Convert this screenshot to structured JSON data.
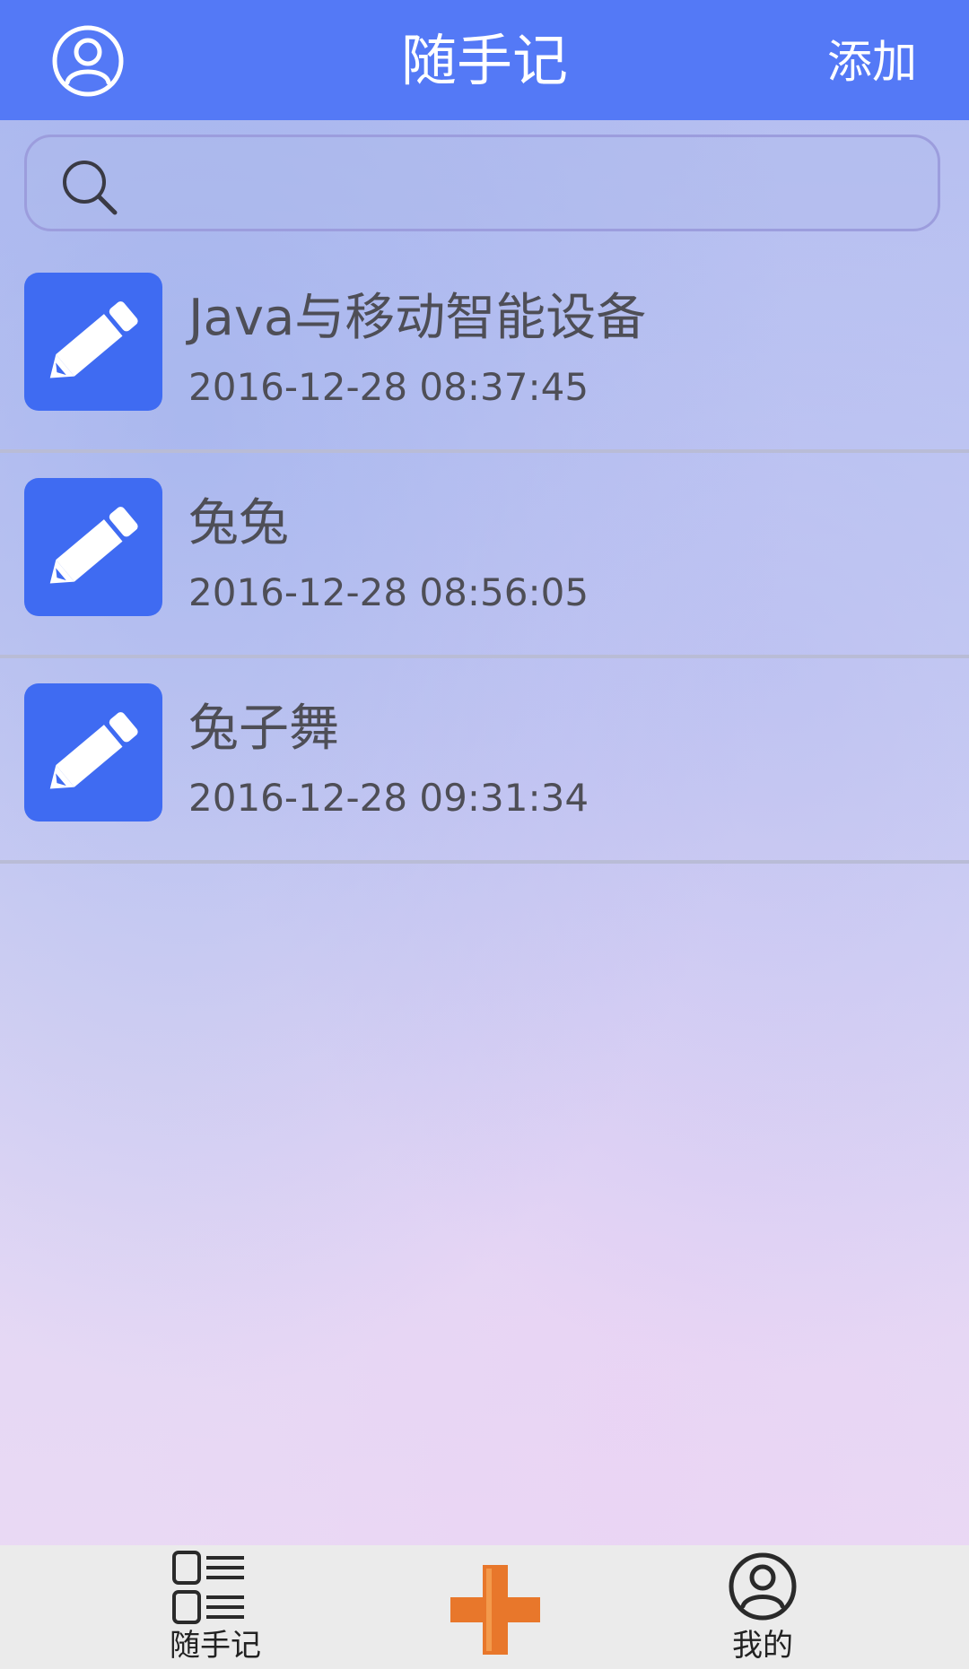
{
  "header": {
    "title": "随手记",
    "add_label": "添加",
    "avatar_icon": "user-circle-icon",
    "background_color": "#5479f6"
  },
  "search": {
    "placeholder": "",
    "value": "",
    "icon": "search-icon"
  },
  "notes": [
    {
      "title": "Java与移动智能设备",
      "time": "2016-12-28 08:37:45",
      "icon": "pencil-icon"
    },
    {
      "title": "兔兔",
      "time": "2016-12-28 08:56:05",
      "icon": "pencil-icon"
    },
    {
      "title": "兔子舞",
      "time": "2016-12-28 09:31:34",
      "icon": "pencil-icon"
    }
  ],
  "bottom_nav": {
    "items": [
      {
        "label": "随手记",
        "icon": "list-icon"
      },
      {
        "label": "",
        "icon": "plus-icon"
      },
      {
        "label": "我的",
        "icon": "user-circle-icon"
      }
    ]
  },
  "colors": {
    "note_icon_bg": "#3f6bf2",
    "add_accent": "#e8772b",
    "text": "#4e4e56"
  }
}
